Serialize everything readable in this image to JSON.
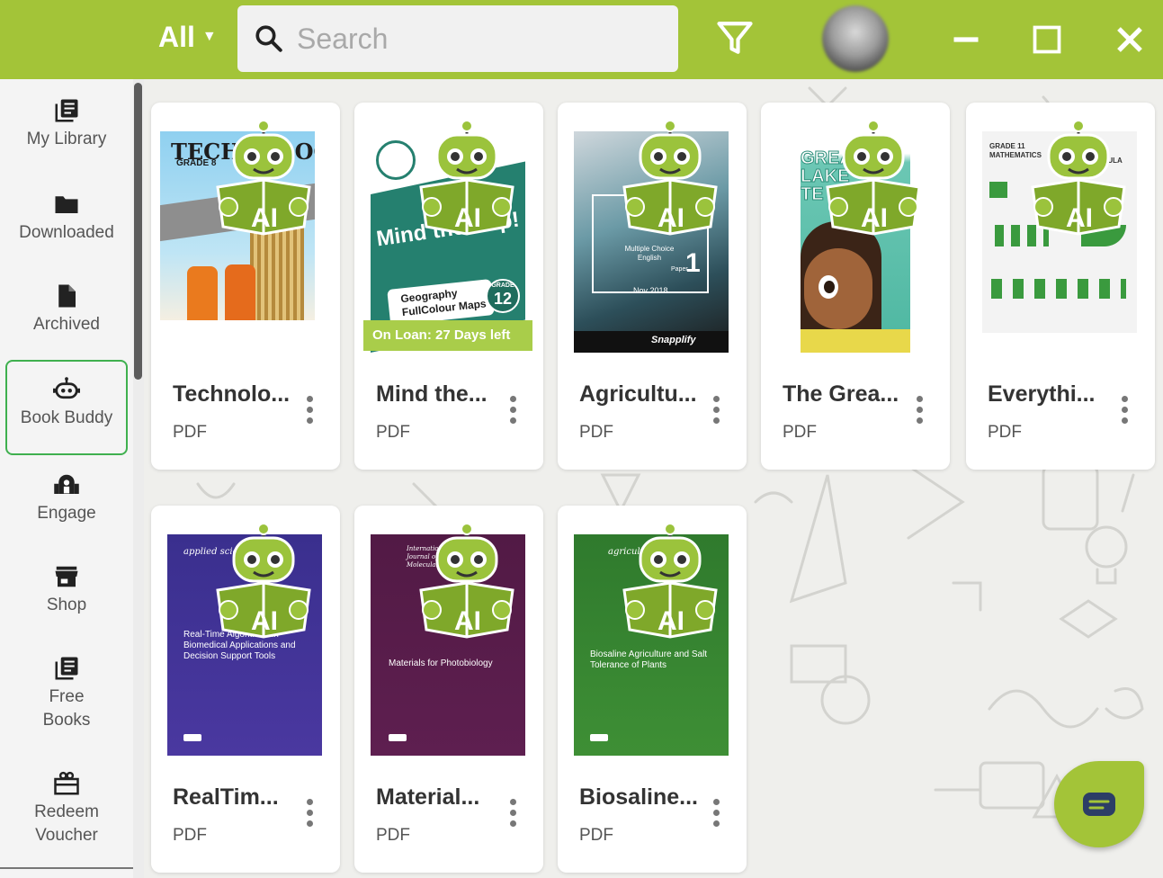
{
  "header": {
    "filter_label": "All",
    "search_placeholder": "Search"
  },
  "sidebar": {
    "items": [
      {
        "label": "My Library",
        "icon": "library-icon"
      },
      {
        "label": "Downloaded",
        "icon": "folder-icon"
      },
      {
        "label": "Archived",
        "icon": "file-icon"
      },
      {
        "label": "Book Buddy",
        "icon": "robot-icon"
      },
      {
        "label": "Engage",
        "icon": "group-icon"
      },
      {
        "label": "Shop",
        "icon": "store-icon"
      },
      {
        "label": "Free Books",
        "icon": "library-icon"
      },
      {
        "label": "Redeem Voucher",
        "icon": "gift-icon"
      }
    ]
  },
  "books": [
    {
      "title": "Technolo...",
      "type": "PDF",
      "cover_title": "TECHNOLOGY",
      "cover_sub": "GRADE 8"
    },
    {
      "title": "Mind the...",
      "type": "PDF",
      "loan": "On Loan: 27 Days left",
      "cover_title": "Mind the Gap!",
      "cover_sub": "Geography FullColour Maps",
      "cover_grade_label": "GRADE",
      "cover_grade": "12"
    },
    {
      "title": "Agricultu...",
      "type": "PDF",
      "cover_sub": "Multiple Choice English",
      "cover_extra": "Nov 2018",
      "cover_paper_label": "Paper",
      "cover_paper": "1",
      "cover_brand": "Snapplify"
    },
    {
      "title": "The Grea...",
      "type": "PDF",
      "cover_title": "GREAT LAKE TE"
    },
    {
      "title": "Everythi...",
      "type": "PDF",
      "cover_sub": "GRADE 11 MATHEMATICS",
      "cover_brand": "VULA"
    },
    {
      "title": "RealTim...",
      "type": "PDF",
      "cover_brand": "applied sciences",
      "cover_sub": "Real-Time Algorithms in Biomedical Applications and Decision Support Tools"
    },
    {
      "title": "Material...",
      "type": "PDF",
      "cover_brand": "International Journal of Molecular Sciences",
      "cover_sub": "Materials for Photobiology"
    },
    {
      "title": "Biosaline...",
      "type": "PDF",
      "cover_brand": "agriculture",
      "cover_sub": "Biosaline Agriculture and Salt Tolerance of Plants"
    }
  ],
  "badge_text": "AI",
  "colors": {
    "brand_green": "#a3c438",
    "active_border": "#3fb04f"
  }
}
